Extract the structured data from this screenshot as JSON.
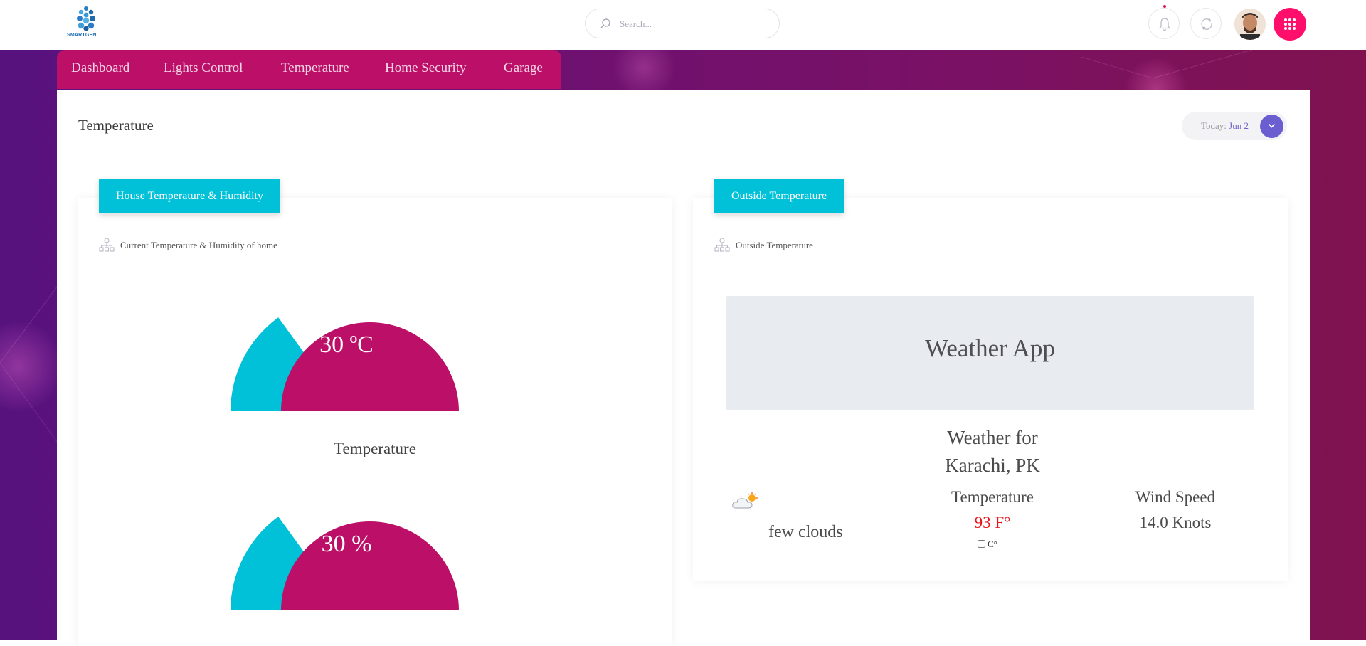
{
  "header": {
    "logo_text": "SMARTGEN",
    "search_placeholder": "Search...",
    "icons": [
      "bell-icon",
      "sync-icon",
      "avatar",
      "apps-grid-icon"
    ],
    "accent_color": "#ff0f6b"
  },
  "nav": {
    "items": [
      {
        "label": "Dashboard"
      },
      {
        "label": "Lights Control"
      },
      {
        "label": "Temperature"
      },
      {
        "label": "Home Security"
      },
      {
        "label": "Garage"
      }
    ],
    "color": "#bc0f67"
  },
  "page": {
    "title": "Temperature",
    "date_prefix": "Today:",
    "date_value": "Jun 2"
  },
  "house_card": {
    "tab_label": "House Temperature & Humidity",
    "subtitle": "Current Temperature & Humidity of home",
    "gauges": [
      {
        "value_text": "30 ºC",
        "label": "Temperature",
        "fraction": 0.3,
        "fill_color": "#00c1d8",
        "base_color": "#bc0f67"
      },
      {
        "value_text": "30 %",
        "label": "",
        "fraction": 0.3,
        "fill_color": "#00c1d8",
        "base_color": "#bc0f67"
      }
    ]
  },
  "outside_card": {
    "tab_label": "Outside Temperature",
    "subtitle": "Outside Temperature",
    "weather": {
      "banner_title": "Weather App",
      "place_line1": "Weather for",
      "place_line2": "Karachi, PK",
      "icon": "few-clouds-icon",
      "description": "few clouds",
      "temperature_label": "Temperature",
      "temperature_value": "93 F°",
      "unit_toggle_label": "C°",
      "wind_label": "Wind Speed",
      "wind_value": "14.0 Knots"
    },
    "tab_color": "#00c1d8"
  }
}
